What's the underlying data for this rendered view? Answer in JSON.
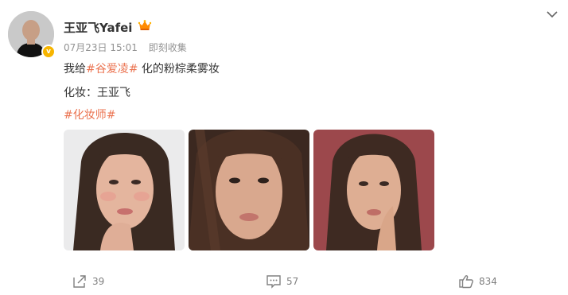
{
  "post": {
    "author": "王亚飞Yafei",
    "date": "07月23日 15:01",
    "source": "即刻收集",
    "verified_badge": "v",
    "crown_icon": "crown-icon",
    "collapse_icon": "chevron-down-icon",
    "text_line1": {
      "before": "我给",
      "tag": "#谷爱凌#",
      "after": " 化的粉棕柔雾妆"
    },
    "text_line2": "化妆：王亚飞",
    "text_line3_tag": "#化妆师#",
    "images": [
      {
        "name": "photo-1",
        "background": "#e9e9ea"
      },
      {
        "name": "photo-2",
        "background": "#3a2820"
      },
      {
        "name": "photo-3",
        "background": "#9e4a4e"
      }
    ]
  },
  "actions": {
    "repost": {
      "icon": "share-icon",
      "count": "39"
    },
    "comment": {
      "icon": "comment-icon",
      "count": "57"
    },
    "like": {
      "icon": "thumbs-up-icon",
      "count": "834"
    }
  },
  "colors": {
    "accent": "#eb7350",
    "meta": "#939393",
    "text": "#333333"
  }
}
